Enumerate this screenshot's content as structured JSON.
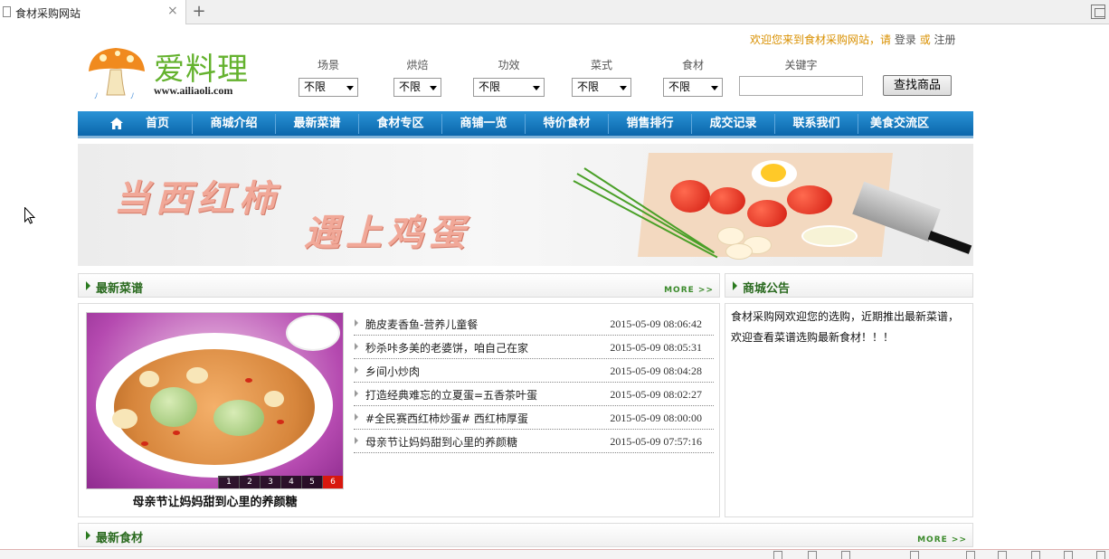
{
  "browser": {
    "tab_title": "食材采购网站",
    "close_glyph": "×",
    "new_tab_glyph": "+"
  },
  "header": {
    "welcome_text": "欢迎您来到食材采购网站，请",
    "login_label": "登录",
    "or_text": "或",
    "register_label": "注册",
    "logo_text": "爱料理",
    "logo_url": "www.ailiaoli.com"
  },
  "filters": [
    {
      "label": "场景",
      "value": "不限"
    },
    {
      "label": "烘焙",
      "value": "不限"
    },
    {
      "label": "功效",
      "value": "不限"
    },
    {
      "label": "菜式",
      "value": "不限"
    },
    {
      "label": "食材",
      "value": "不限"
    }
  ],
  "keyword": {
    "label": "关键字",
    "value": ""
  },
  "search_button_label": "查找商品",
  "nav": [
    "首页",
    "商城介绍",
    "最新菜谱",
    "食材专区",
    "商铺一览",
    "特价食材",
    "销售排行",
    "成交记录",
    "联系我们",
    "美食交流区"
  ],
  "banner": {
    "line1": "当西红柿",
    "line2": "遇上鸡蛋"
  },
  "recipes_panel": {
    "title": "最新菜谱",
    "more": "MORE >>",
    "feature_caption": "母亲节让妈妈甜到心里的养颜糖",
    "pager": [
      "1",
      "2",
      "3",
      "4",
      "5",
      "6"
    ],
    "active_page": "6",
    "items": [
      {
        "title": "脆皮麦香鱼-营养儿童餐",
        "date": "2015-05-09 08:06:42"
      },
      {
        "title": "秒杀咔多美的老婆饼，咱自己在家",
        "date": "2015-05-09 08:05:31"
      },
      {
        "title": "乡间小炒肉",
        "date": "2015-05-09 08:04:28"
      },
      {
        "title": "打造经典难忘的立夏蛋=五香茶叶蛋",
        "date": "2015-05-09 08:02:27"
      },
      {
        "title": "#全民赛西红柿炒蛋# 西红柿厚蛋",
        "date": "2015-05-09 08:00:00"
      },
      {
        "title": "母亲节让妈妈甜到心里的养颜糖",
        "date": "2015-05-09 07:57:16"
      }
    ]
  },
  "notice_panel": {
    "title": "商城公告",
    "text": "食材采购网欢迎您的选购，近期推出最新菜谱，欢迎查看菜谱选购最新食材！！！"
  },
  "ingredients_panel": {
    "title": "最新食材",
    "more": "MORE >>"
  },
  "colors": {
    "nav_blue": "#0a66ab",
    "logo_green": "#64b22e",
    "panel_title_green": "#2a6a1f",
    "welcome_orange": "#d99000",
    "pager_active": "#d8180e"
  }
}
